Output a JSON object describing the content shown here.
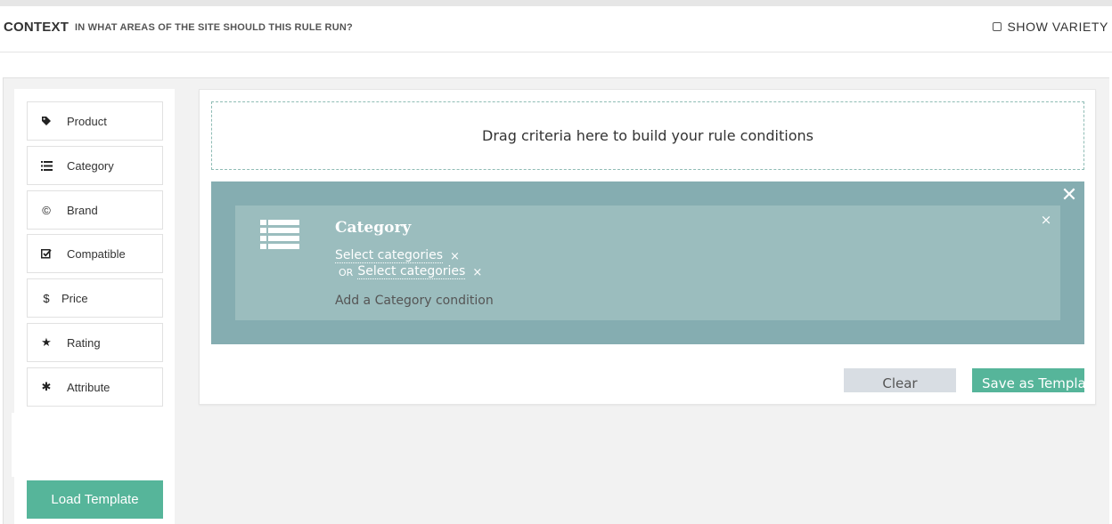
{
  "header": {
    "title": "CONTEXT",
    "subtitle": "IN WHAT AREAS OF THE SITE SHOULD THIS RULE RUN?",
    "variety_label": "SHOW VARIETY",
    "variety_checked": false
  },
  "sidebar": {
    "items": [
      {
        "label": "Product",
        "icon": "tag-icon"
      },
      {
        "label": "Category",
        "icon": "list-icon"
      },
      {
        "label": "Brand",
        "icon": "copyright-icon"
      },
      {
        "label": "Compatible",
        "icon": "check-square-icon"
      },
      {
        "label": "Price",
        "icon": "dollar-icon"
      },
      {
        "label": "Rating",
        "icon": "star-icon"
      },
      {
        "label": "Attribute",
        "icon": "asterisk-icon"
      }
    ],
    "load_template_label": "Load Template"
  },
  "builder": {
    "dropzone_text": "Drag criteria here to build your rule conditions",
    "group_close": "✕",
    "condition": {
      "title": "Category",
      "icon": "list-icon",
      "close": "×",
      "selections": [
        {
          "prefix": "",
          "label": "Select categories",
          "remove": "×"
        },
        {
          "prefix": "OR",
          "label": "Select categories",
          "remove": "×"
        }
      ],
      "add_label": "Add a Category condition"
    },
    "clear_label": "Clear",
    "save_label": "Save as Template"
  },
  "colors": {
    "accent": "#56b59a",
    "group_bg": "#85adb1",
    "condition_bg": "#9bbdbe",
    "clear_bg": "#d8dde3"
  }
}
